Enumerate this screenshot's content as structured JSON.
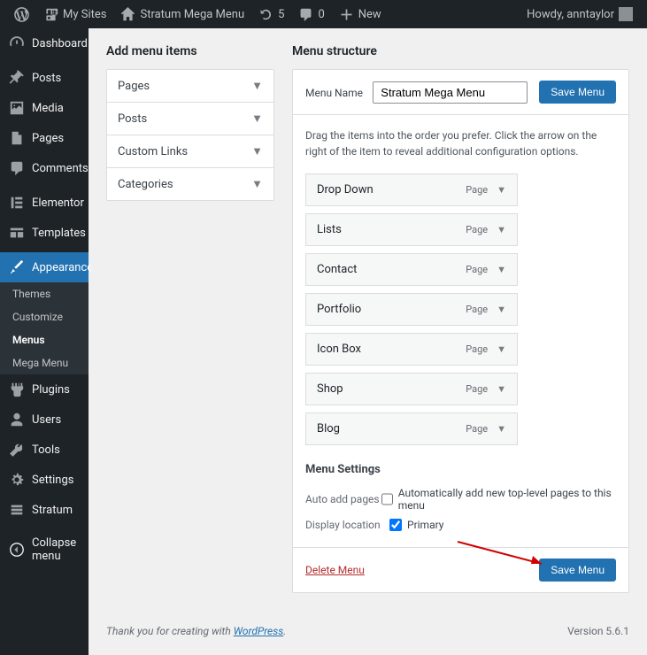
{
  "adminbar": {
    "my_sites": "My Sites",
    "site_name": "Stratum Mega Menu",
    "updates": "5",
    "comments": "0",
    "new": "New",
    "howdy": "Howdy, anntaylor"
  },
  "sidebar": {
    "items": [
      {
        "label": "Dashboard"
      },
      {
        "label": "Posts"
      },
      {
        "label": "Media"
      },
      {
        "label": "Pages"
      },
      {
        "label": "Comments"
      },
      {
        "label": "Elementor"
      },
      {
        "label": "Templates"
      },
      {
        "label": "Appearance"
      },
      {
        "label": "Plugins"
      },
      {
        "label": "Users"
      },
      {
        "label": "Tools"
      },
      {
        "label": "Settings"
      },
      {
        "label": "Stratum"
      },
      {
        "label": "Collapse menu"
      }
    ],
    "sub": [
      "Themes",
      "Customize",
      "Menus",
      "Mega Menu"
    ]
  },
  "headings": {
    "add": "Add menu items",
    "structure": "Menu structure"
  },
  "accordion": [
    "Pages",
    "Posts",
    "Custom Links",
    "Categories"
  ],
  "panel": {
    "menu_name_label": "Menu Name",
    "menu_name_value": "Stratum Mega Menu",
    "save_btn": "Save Menu",
    "hint": "Drag the items into the order you prefer. Click the arrow on the right of the item to reveal additional configuration options.",
    "items": [
      {
        "label": "Drop Down",
        "type": "Page"
      },
      {
        "label": "Lists",
        "type": "Page"
      },
      {
        "label": "Contact",
        "type": "Page"
      },
      {
        "label": "Portfolio",
        "type": "Page"
      },
      {
        "label": "Icon Box",
        "type": "Page"
      },
      {
        "label": "Shop",
        "type": "Page"
      },
      {
        "label": "Blog",
        "type": "Page"
      }
    ],
    "settings": {
      "title": "Menu Settings",
      "auto_label": "Auto add pages",
      "auto_text": "Automatically add new top-level pages to this menu",
      "display_label": "Display location",
      "primary": "Primary"
    },
    "delete": "Delete Menu"
  },
  "footer": {
    "thanks_pre": "Thank you for creating with ",
    "thanks_link": "WordPress",
    "thanks_post": ".",
    "version": "Version 5.6.1"
  }
}
